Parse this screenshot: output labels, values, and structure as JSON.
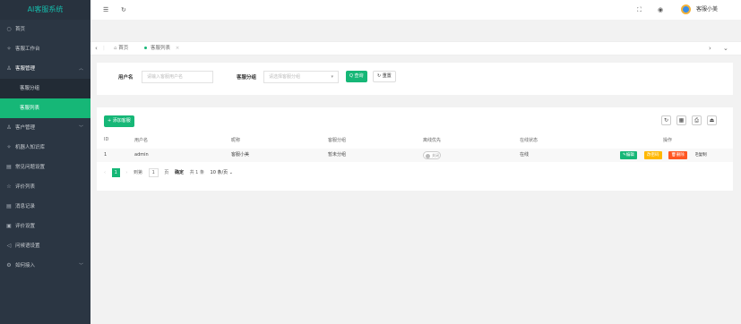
{
  "app": {
    "title": "AI客服系统"
  },
  "sidebar": {
    "items": [
      {
        "label": "首页",
        "icon": "○"
      },
      {
        "label": "客服工作台",
        "icon": "✧"
      },
      {
        "label": "客服管理",
        "icon": "♙",
        "arrow": "︿"
      }
    ],
    "subitems": [
      {
        "label": "客服分组"
      },
      {
        "label": "客服列表"
      }
    ],
    "items2": [
      {
        "label": "客户管理",
        "icon": "♙",
        "arrow": "﹀"
      },
      {
        "label": "机器人知识库",
        "icon": "✧"
      },
      {
        "label": "常见问题设置",
        "icon": "▤"
      },
      {
        "label": "评价列表",
        "icon": "☆"
      },
      {
        "label": "消息记录",
        "icon": "▤"
      },
      {
        "label": "评价设置",
        "icon": "▣"
      },
      {
        "label": "问候语设置",
        "icon": "◁"
      },
      {
        "label": "如何接入",
        "icon": "⚙",
        "arrow": "﹀"
      }
    ]
  },
  "header": {
    "menu_icon": "☰",
    "refresh_icon": "↻",
    "fullscreen_icon": "⛶",
    "theme_icon": "◉",
    "user_name": "客服小美"
  },
  "tabs": {
    "left_arrow": "‹",
    "home": "首页",
    "current": "客服列表",
    "close": "×",
    "right_arrow": "›",
    "down_arrow": "⌄"
  },
  "search": {
    "username_label": "用户名",
    "username_placeholder": "请输入客服用户名",
    "group_label": "客服分组",
    "group_placeholder": "请选择客服分组",
    "query_button": "Q 查询",
    "reset_button": "↻ 重置"
  },
  "table": {
    "add_button": "+ 添加客服",
    "tools": [
      "↻",
      "▦",
      "⎙",
      "⏏"
    ],
    "headers": [
      "ID",
      "用户名",
      "昵称",
      "客服分组",
      "离线优先",
      "在线状态",
      "操作"
    ],
    "rows": [
      {
        "id": "1",
        "username": "admin",
        "nickname": "客服小美",
        "group": "暂未分组",
        "offline_priority": "关闭",
        "status": "在线"
      }
    ],
    "actions": {
      "edit": "✎编辑",
      "password": "改密码",
      "delete": "🗑删除",
      "copy": "⎘复制"
    },
    "pager": {
      "prev": "‹",
      "current": "1",
      "next": "›",
      "goto_label": "到第",
      "page_input": "1",
      "page_unit": "页",
      "confirm": "确定",
      "total": "共 1 条",
      "per_page": "10 条/页 ⌄"
    }
  }
}
